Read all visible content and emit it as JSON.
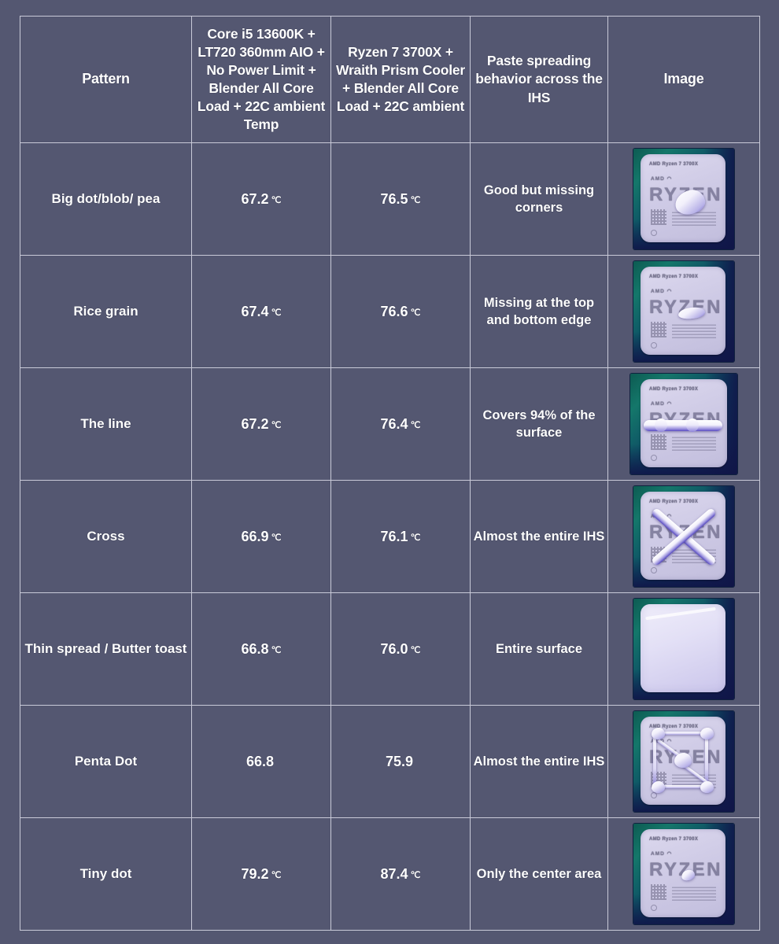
{
  "table": {
    "columns": [
      {
        "key": "pattern",
        "label": "Pattern"
      },
      {
        "key": "intel",
        "label": "Core i5 13600K + LT720 360mm AIO + No Power Limit + Blender All Core Load + 22C ambient Temp"
      },
      {
        "key": "amd",
        "label": "Ryzen 7 3700X + Wraith Prism Cooler + Blender All Core Load + 22C ambient"
      },
      {
        "key": "behavior",
        "label": "Paste spreading behavior across the IHS"
      },
      {
        "key": "image",
        "label": "Image"
      }
    ],
    "unit": "℃",
    "rows": [
      {
        "pattern": "Big dot/blob/ pea",
        "intel_temp": "67.2",
        "intel_unit": "℃",
        "amd_temp": "76.5",
        "amd_unit": "℃",
        "behavior": "Good but missing corners",
        "image_alt": "AMD Ryzen 7 3700X CPU with a single large paste blob at the center of the IHS"
      },
      {
        "pattern": "Rice grain",
        "intel_temp": "67.4",
        "intel_unit": "℃",
        "amd_temp": "76.6",
        "amd_unit": "℃",
        "behavior": "Missing at the top and bottom edge",
        "image_alt": "AMD Ryzen 7 3700X CPU with a small rice-grain shaped paste line at the center"
      },
      {
        "pattern": "The line",
        "intel_temp": "67.2",
        "intel_unit": "℃",
        "amd_temp": "76.4",
        "amd_unit": "℃",
        "behavior": "Covers 94% of the surface",
        "image_alt": "AMD Ryzen 7 3700X CPU with one horizontal paste line across the IHS"
      },
      {
        "pattern": "Cross",
        "intel_temp": "66.9",
        "intel_unit": "℃",
        "amd_temp": "76.1",
        "amd_unit": "℃",
        "behavior": "Almost the entire IHS",
        "image_alt": "AMD Ryzen 7 3700X CPU with an X shaped cross of paste across the IHS"
      },
      {
        "pattern": "Thin spread / Butter toast",
        "intel_temp": "66.8",
        "intel_unit": "℃",
        "amd_temp": "76.0",
        "amd_unit": "℃",
        "behavior": "Entire surface",
        "image_alt": "AMD Ryzen 7 3700X CPU with paste spread thinly over the entire IHS"
      },
      {
        "pattern": "Penta Dot",
        "intel_temp": "66.8",
        "intel_unit": "",
        "amd_temp": "75.9",
        "amd_unit": "",
        "behavior": "Almost the entire IHS",
        "image_alt": "AMD Ryzen 7 3700X CPU with five paste dots, four corners and one center"
      },
      {
        "pattern": "Tiny dot",
        "intel_temp": "79.2",
        "intel_unit": "℃",
        "amd_temp": "87.4",
        "amd_unit": "℃",
        "behavior": "Only the center area",
        "image_alt": "AMD Ryzen 7 3700X CPU with one tiny paste dot at the center"
      }
    ]
  },
  "cpu_label": {
    "top": "AMD Ryzen 7 3700X",
    "amd": "AMD ◠",
    "ryzen": "RYZEN"
  },
  "colors": {
    "background": "#545771",
    "cell_background": "#545771",
    "border": "#c9cad8",
    "text": "#ffffff"
  }
}
